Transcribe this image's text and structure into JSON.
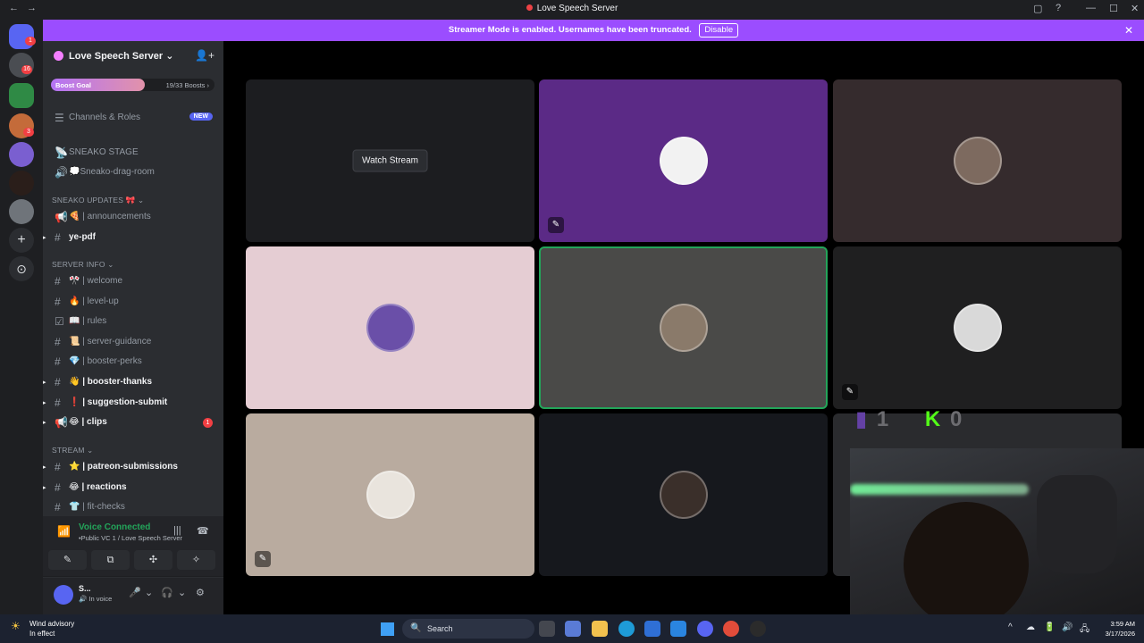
{
  "window": {
    "title": "Love Speech Server",
    "nav_back": "←",
    "nav_forward": "→",
    "inbox_icon": "▢",
    "help_icon": "?",
    "minimize": "—",
    "maximize": "☐",
    "close": "✕"
  },
  "banner": {
    "text": "Streamer Mode is enabled. Usernames have been truncated.",
    "disable_label": "Disable",
    "close": "✕"
  },
  "rail": {
    "badges": [
      "1",
      "16",
      "3"
    ],
    "add_server": "+",
    "discover": "⊙"
  },
  "sidebar": {
    "server_name": "Love Speech Server",
    "chevron": "⌄",
    "invite_icon": "👤+",
    "boost": {
      "label": "Boost Goal",
      "count": "19/33 Boosts",
      "chevron": "›",
      "progress": 0.576
    },
    "channels_roles": {
      "label": "Channels & Roles",
      "badge": "NEW",
      "icon": "☰"
    },
    "items": [
      {
        "icon": "📡",
        "label": "SNEAKO STAGE"
      },
      {
        "icon": "🔊",
        "label": "💭Sneako-drag-room"
      }
    ],
    "cat_updates": "SNEAKO UPDATES 🎀 ⌄",
    "announcements": {
      "icon": "📢",
      "label": "🍕 | announcements"
    },
    "ye_pdf": {
      "icon": "#",
      "label": "ye-pdf",
      "pip": "▸"
    },
    "cat_server_info": "SERVER INFO ⌄",
    "server_info": [
      {
        "icon": "#",
        "label": "🎌 | welcome"
      },
      {
        "icon": "#",
        "label": "🔥 | level-up"
      },
      {
        "icon": "☑",
        "label": "📖 | rules"
      },
      {
        "icon": "#",
        "label": "📜 | server-guidance"
      },
      {
        "icon": "#",
        "label": "💎 | booster-perks"
      },
      {
        "icon": "#",
        "label": "👋 | booster-thanks",
        "pip": "▸"
      },
      {
        "icon": "#",
        "label": "❗ | suggestion-submit",
        "pip": "▸"
      },
      {
        "icon": "📢",
        "label": "😂 | clips",
        "pip": "▸",
        "count": "1"
      }
    ],
    "cat_stream": "STREAM ⌄",
    "stream": [
      {
        "icon": "#",
        "label": "⭐ | patreon-submissions",
        "pip": "▸"
      },
      {
        "icon": "#",
        "label": "😂 | reactions",
        "pip": "▸"
      },
      {
        "icon": "#",
        "label": "👕 | fit-checks"
      }
    ]
  },
  "voice": {
    "status": "Voice Connected",
    "channel": "•Public VC 1 / Love Speech Server",
    "signal_icon": "📶",
    "noise_icon": "|||",
    "disconnect_icon": "☎",
    "buttons": [
      "✎",
      "⧉",
      "✣",
      "✧"
    ]
  },
  "user": {
    "name": "S...",
    "status": "🔊 In voice",
    "mic_icon": "🎤",
    "chev": "⌄",
    "headset_icon": "🎧",
    "settings_icon": "⚙"
  },
  "stage": {
    "watch_label": "Watch Stream",
    "muted_icon": "✎",
    "overlay_a": "1",
    "overlay_b": "0",
    "overlay_logo_a": "▮",
    "overlay_logo_b": "K"
  },
  "colors": {
    "accent": "#9b4dff",
    "voice_green": "#23a55a",
    "tile_purple": "#5b2a86",
    "tile_pink": "#e5cdd3",
    "tile_tan": "#b9ab9f"
  },
  "taskbar": {
    "weather_icon": "☀",
    "weather_title": "Wind advisory",
    "weather_sub": "In effect",
    "search_label": "Search",
    "search_icon": "🔍",
    "time": "3:59 AM",
    "date": "3/17/2026",
    "tray": [
      "^",
      "☁",
      "🔋",
      "🔊",
      "🖧"
    ]
  }
}
